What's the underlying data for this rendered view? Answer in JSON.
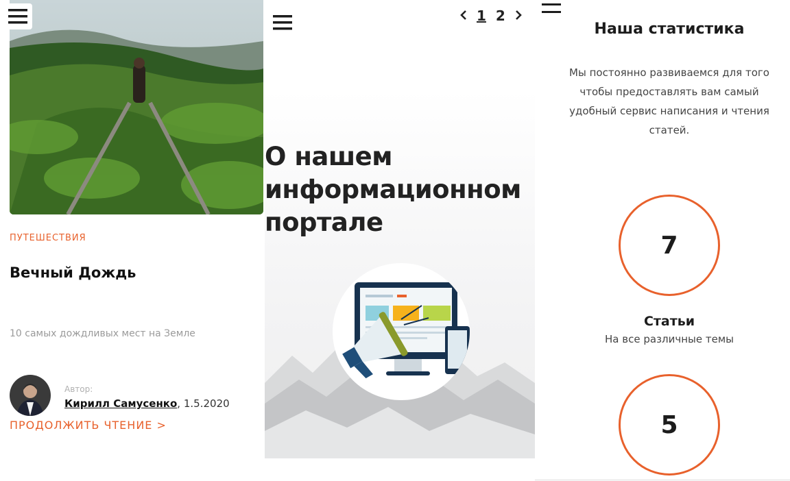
{
  "colors": {
    "accent": "#e8612c",
    "text": "#1f1f1f",
    "muted": "#9a9a9a"
  },
  "article": {
    "category": "ПУТЕШЕСТВИЯ",
    "title": "Вечный Дождь",
    "excerpt": "10 самых дождливых мест на Земле",
    "author_label": "Автор:",
    "author_name": "Кирилл Самусенко",
    "date_sep": ",",
    "date": "1.5.2020",
    "read_more": "ПРОДОЛЖИТЬ ЧТЕНИЕ >"
  },
  "pager": {
    "prev_icon": "chevron-left-icon",
    "pages": [
      "1",
      "2"
    ],
    "current": "1",
    "next_icon": "chevron-right-icon"
  },
  "about": {
    "title": "О нашем информационном портале"
  },
  "stats": {
    "title": "Наша статистика",
    "description": "Мы постоянно развиваемся для того чтобы предоставлять вам самый удобный сервис написания и чтения статей.",
    "items": [
      {
        "value": "7",
        "label": "Статьи",
        "sub": "На все различные темы"
      },
      {
        "value": "5"
      }
    ]
  },
  "icons": {
    "menu": "hamburger-menu-icon",
    "promo": "megaphone-monitor-icon"
  }
}
